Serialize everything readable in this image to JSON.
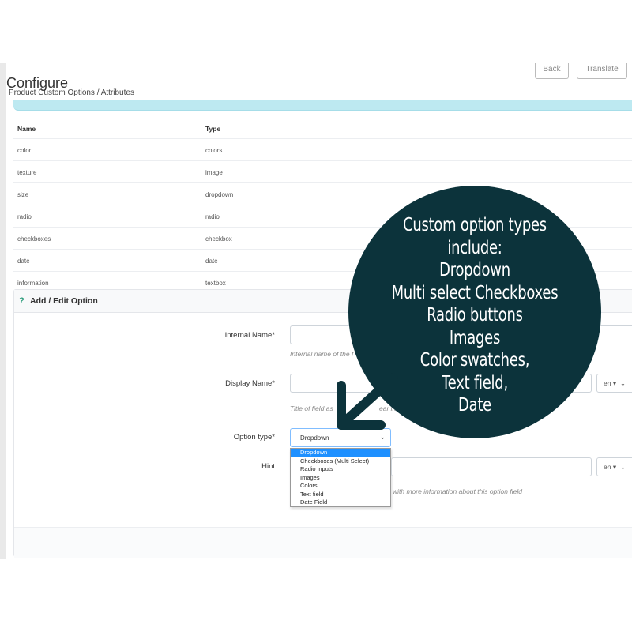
{
  "header": {
    "title": "Configure",
    "breadcrumb": "Product Custom Options / Attributes",
    "back_label": "Back",
    "translate_label": "Translate"
  },
  "table": {
    "columns": [
      "Name",
      "Type"
    ],
    "rows": [
      {
        "name": "color",
        "type": "colors"
      },
      {
        "name": "texture",
        "type": "image"
      },
      {
        "name": "size",
        "type": "dropdown"
      },
      {
        "name": "radio",
        "type": "radio"
      },
      {
        "name": "checkboxes",
        "type": "checkbox"
      },
      {
        "name": "date",
        "type": "date"
      },
      {
        "name": "information",
        "type": "textbox"
      }
    ]
  },
  "panel": {
    "icon": "question-icon",
    "title": "Add / Edit Option",
    "internal_name_label": "Internal Name*",
    "internal_name_help": "Internal name of the f",
    "display_name_label": "Display Name*",
    "display_name_help": "Title of field as",
    "display_name_help_tail": "ear in the s",
    "display_name_lang": "en",
    "option_type_label": "Option type*",
    "option_type_value": "Dropdown",
    "option_type_options": [
      "Dropdown",
      "Checkboxes (Multi Select)",
      "Radio inputs",
      "Images",
      "Colors",
      "Text field",
      "Date Field"
    ],
    "hint_label": "Hint",
    "hint_lang": "en",
    "hint_help": "with more information about this option field"
  },
  "callout": {
    "lines": [
      "Custom option types",
      "include:",
      "Dropdown",
      "Multi select Checkboxes",
      "Radio buttons",
      "Images",
      "Color swatches,",
      "Text field,",
      "Date"
    ],
    "bg_color": "#0c333b",
    "text_color": "#ffffff"
  },
  "colors": {
    "accent": "#1e90ff",
    "info_strip": "#bde9f1"
  }
}
